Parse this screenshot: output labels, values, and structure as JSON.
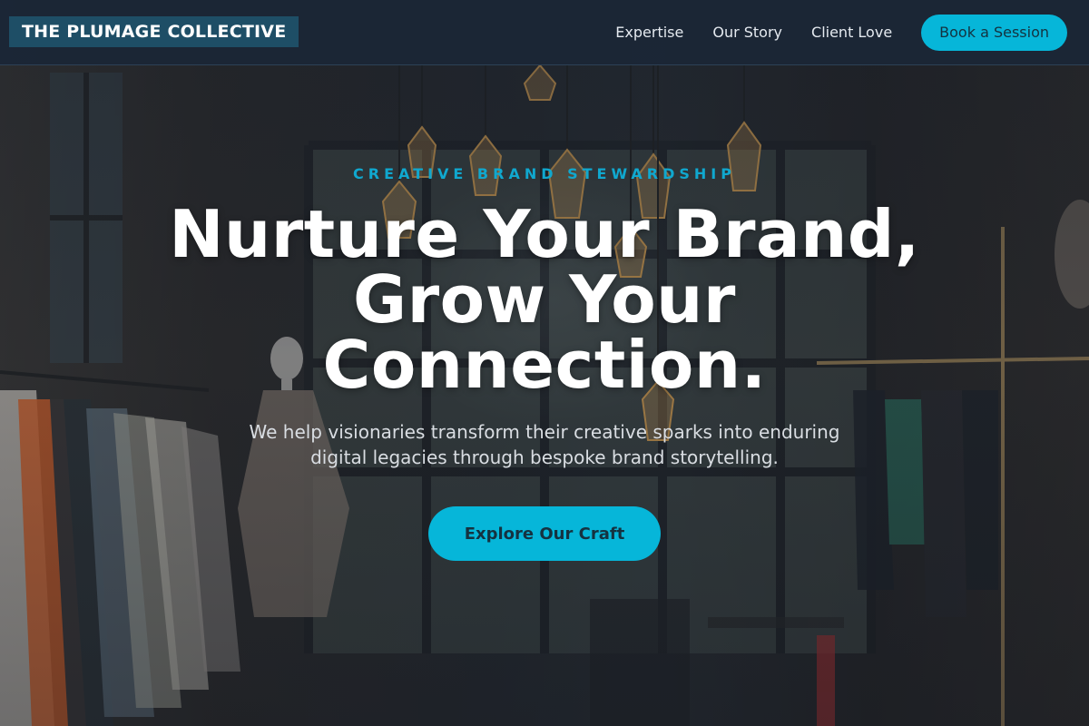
{
  "header": {
    "logo_text": "THE PLUMAGE COLLECTIVE",
    "nav": [
      {
        "label": "Expertise"
      },
      {
        "label": "Our Story"
      },
      {
        "label": "Client Love"
      }
    ],
    "cta_label": "Book a Session"
  },
  "hero": {
    "eyebrow": "CREATIVE BRAND STEWARDSHIP",
    "title": "Nurture Your Brand, Grow Your Connection.",
    "subtitle": "We help visionaries transform their creative sparks into enduring digital legacies through bespoke brand storytelling.",
    "cta_label": "Explore Our Craft"
  },
  "colors": {
    "accent": "#06b6d9",
    "header_bg": "#1b2636",
    "logo_bg": "#1e4e66",
    "eyebrow": "#10a8cf"
  },
  "background": {
    "icon": "boutique-interior-photo"
  }
}
